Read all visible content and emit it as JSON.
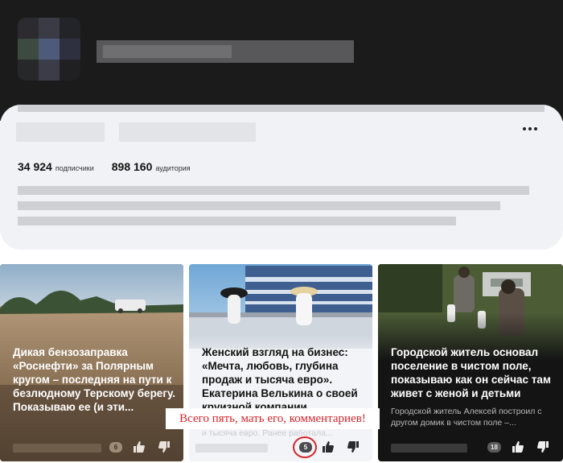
{
  "channel": {
    "subscribers_count": "34 924",
    "subscribers_label": "подписчики",
    "audience_count": "898 160",
    "audience_label": "аудитория",
    "more_icon": "more-horizontal-icon"
  },
  "cards": [
    {
      "title": "Дикая бензозаправка «Роснефти» за Полярным кругом – последняя на пути к безлюдному Терскому берегу. Показываю ее (и эти...",
      "comments": "6",
      "like_icon": "thumb-up-icon",
      "dislike_icon": "thumb-down-icon"
    },
    {
      "title": "Женский взгляд на бизнес: «Мечта, любовь, глубина продаж и тысяча евро». Екатерина Велькина о своей круизной компании",
      "faded_line": "и тысяча евро. Ранее работала...",
      "comments": "5",
      "like_icon": "thumb-up-icon",
      "dislike_icon": "thumb-down-icon"
    },
    {
      "title": "Городской житель основал поселение в чистом поле, показываю как он сейчас там живет с женой и детьми",
      "subtitle": "Городской житель Алексей построил с другом домик в чистом поле –...",
      "comments": "18",
      "like_icon": "thumb-up-icon",
      "dislike_icon": "thumb-down-icon"
    }
  ],
  "annotation": {
    "caption": "Всего пять, мать его, комментариев!"
  },
  "colors": {
    "header_bg": "#1b1b1c",
    "info_bg": "#f1f2f6",
    "annotation_red": "#d5242a"
  }
}
